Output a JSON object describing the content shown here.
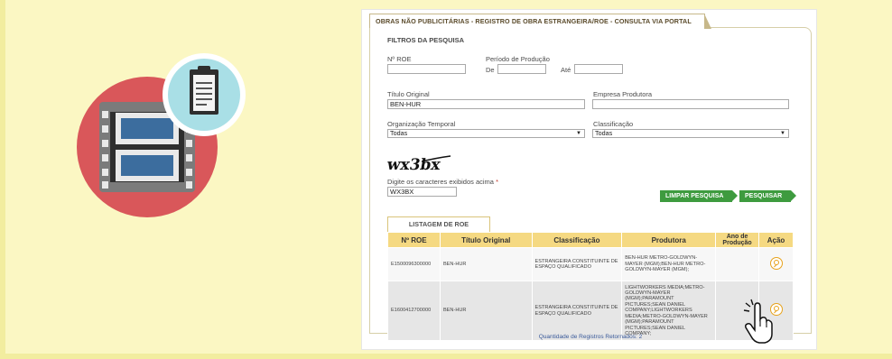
{
  "colors": {
    "background": "#fbf7c3",
    "circle_red": "#d9575a",
    "badge_blue": "#a9dfe6",
    "button_green": "#3e9b3f",
    "table_header": "#f5d982",
    "search_icon_orange": "#e7a21c"
  },
  "illustration": {
    "main_icon": "film-strip-icon",
    "badge_icon": "clipboard-icon"
  },
  "page": {
    "tab_title": "OBRAS NÃO PUBLICITÁRIAS - REGISTRO DE OBRA ESTRANGEIRA/ROE - CONSULTA VIA PORTAL"
  },
  "filters": {
    "section_title": "FILTROS DA PESQUISA",
    "roe_label": "Nº ROE",
    "roe_value": "",
    "period_label": "Período de Produção",
    "from_label": "De",
    "from_value": "",
    "to_label": "Até",
    "to_value": "",
    "title_label": "Título Original",
    "title_value": "BEN-HUR",
    "company_label": "Empresa Produtora",
    "company_value": "",
    "org_label": "Organização Temporal",
    "org_value": "Todas",
    "class_label": "Classificação",
    "class_value": "Todas",
    "captcha_image_text": "wx3bx",
    "captcha_label": "Digite os caracteres exibidos acima",
    "captcha_required": "*",
    "captcha_value": "WX3BX",
    "clear_button": "LIMPAR PESQUISA",
    "search_button": "PESQUISAR"
  },
  "results": {
    "tab_label": "LISTAGEM DE ROE",
    "columns": [
      "Nº ROE",
      "Título Original",
      "Classificação",
      "Produtora",
      "Ano de Produção",
      "Ação"
    ],
    "rows": [
      {
        "roe": "E1500096300000",
        "title": "BEN-HUR",
        "classification": "ESTRANGEIRA CONSTITUINTE DE ESPAÇO QUALIFICADO",
        "producer": "BEN-HUR METRO-GOLDWYN-MAYER (MGM);BEN-HUR METRO-GOLDWYN-MAYER (MGM);",
        "year": "",
        "action_icon": "search-icon"
      },
      {
        "roe": "E1600412700000",
        "title": "BEN-HUR",
        "classification": "ESTRANGEIRA CONSTITUINTE DE ESPAÇO QUALIFICADO",
        "producer": "LIGHTWORKERS MEDIA;METRO-GOLDWYN-MAYER (MGM);PARAMOUNT PICTURES;SEAN DANIEL COMPANY;LIGHTWORKERS MEDIA;METRO-GOLDWYN-MAYER (MGM);PARAMOUNT PICTURES;SEAN DANIEL COMPANY;",
        "year": "",
        "action_icon": "search-icon"
      }
    ],
    "count_text": "Quantidade de Registros Retornados: 2"
  },
  "cursor": {
    "icon": "hand-pointer-icon"
  }
}
